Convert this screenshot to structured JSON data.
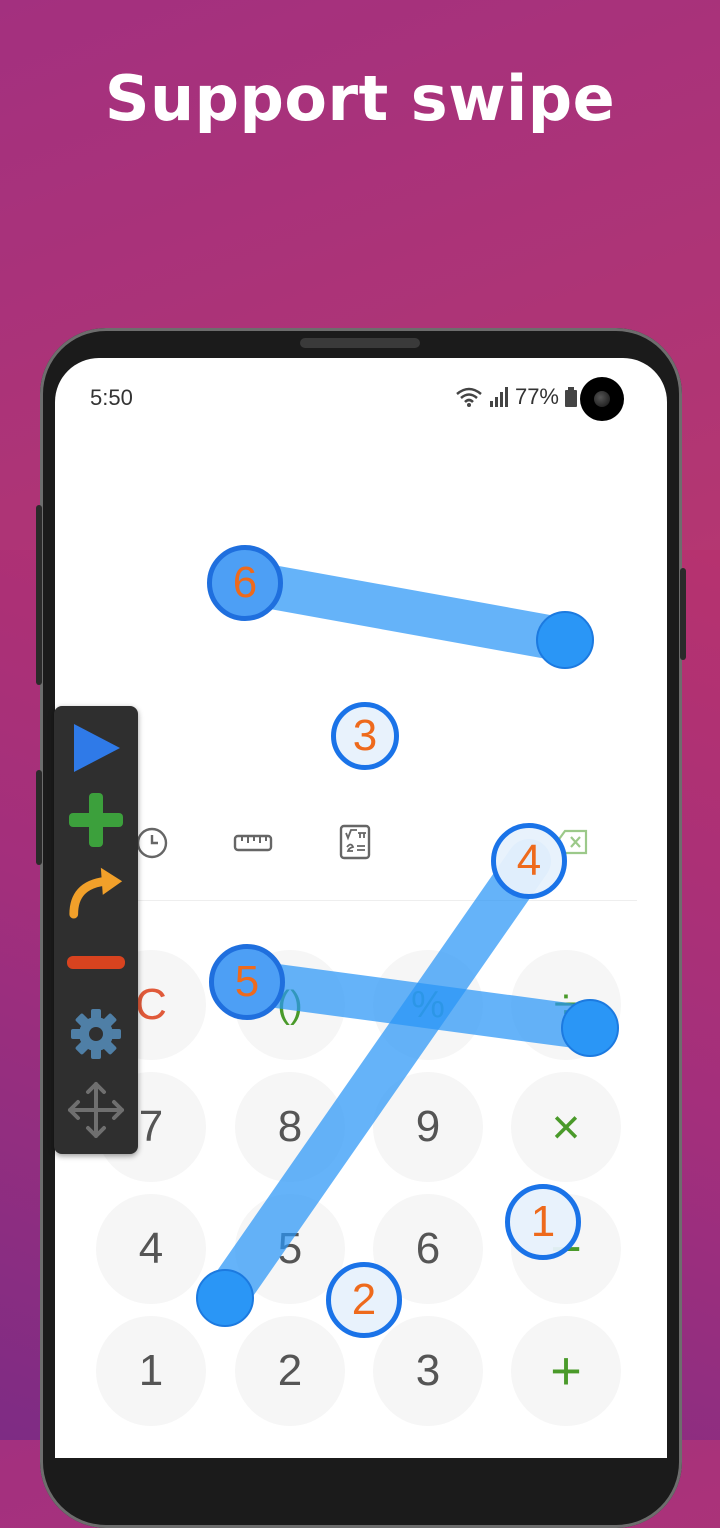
{
  "headline": "Support swipe",
  "status": {
    "time": "5:50",
    "battery": "77%"
  },
  "keypad": {
    "row1": [
      "C",
      "()",
      "%",
      "÷"
    ],
    "row2": [
      "7",
      "8",
      "9",
      "×"
    ],
    "row3": [
      "4",
      "5",
      "6",
      "−"
    ],
    "row4": [
      "1",
      "2",
      "3",
      "+"
    ]
  },
  "markers": [
    "1",
    "2",
    "3",
    "4",
    "5",
    "6"
  ],
  "colors": {
    "accent_blue": "#2a96f6",
    "marker_text": "#ee6a1c",
    "key_red": "#e05a3a",
    "key_green": "#4a9a2a"
  },
  "icons": {
    "toolbar": [
      "play-icon",
      "plus-icon",
      "redo-arrow-icon",
      "minus-icon",
      "gear-icon",
      "move-icon"
    ],
    "tools": [
      "history-icon",
      "ruler-icon",
      "scientific-icon",
      "backspace-icon"
    ]
  }
}
